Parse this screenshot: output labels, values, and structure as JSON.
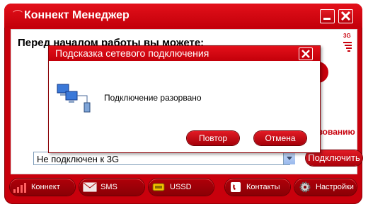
{
  "app": {
    "title": "Коннект Менеджер",
    "heading": "Перед началом работы вы можете:",
    "network_type": "3G",
    "partial_link_text": "зованию"
  },
  "connection": {
    "status_value": "Не подключен к 3G",
    "connect_button": "Подключить"
  },
  "nav": {
    "items": [
      {
        "label": "Коннект",
        "icon": "signal-bars-icon"
      },
      {
        "label": "SMS",
        "icon": "envelope-icon"
      },
      {
        "label": "USSD",
        "icon": "ussd-icon"
      },
      {
        "label": "Контакты",
        "icon": "contacts-icon"
      },
      {
        "label": "Настройки",
        "icon": "gear-icon"
      }
    ]
  },
  "dialog": {
    "title": "Подсказка сетевого подключения",
    "message": "Подключение разорвано",
    "retry_button": "Повтор",
    "cancel_button": "Отмена"
  },
  "colors": {
    "brand_red": "#c8000c",
    "dark_red": "#8a0006"
  }
}
